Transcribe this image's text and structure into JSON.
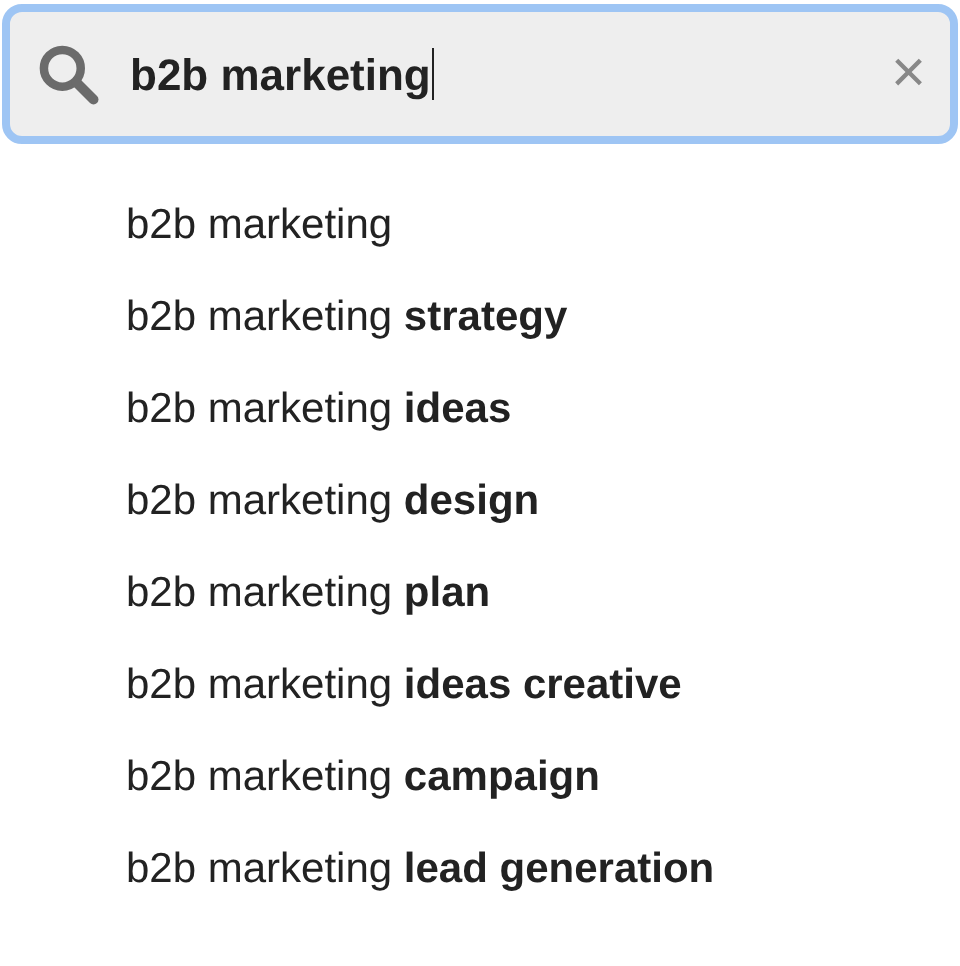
{
  "search": {
    "value": "b2b marketing",
    "focused": true,
    "clear": "×"
  },
  "suggestions": [
    "b2b marketing",
    "b2b marketing **strategy**",
    "b2b marketing **ideas**",
    "b2b marketing **design**",
    "b2b marketing **plan**",
    "b2b marketing **ideas creative**",
    "b2b marketing **campaign**",
    "b2b marketing **lead generation**"
  ]
}
